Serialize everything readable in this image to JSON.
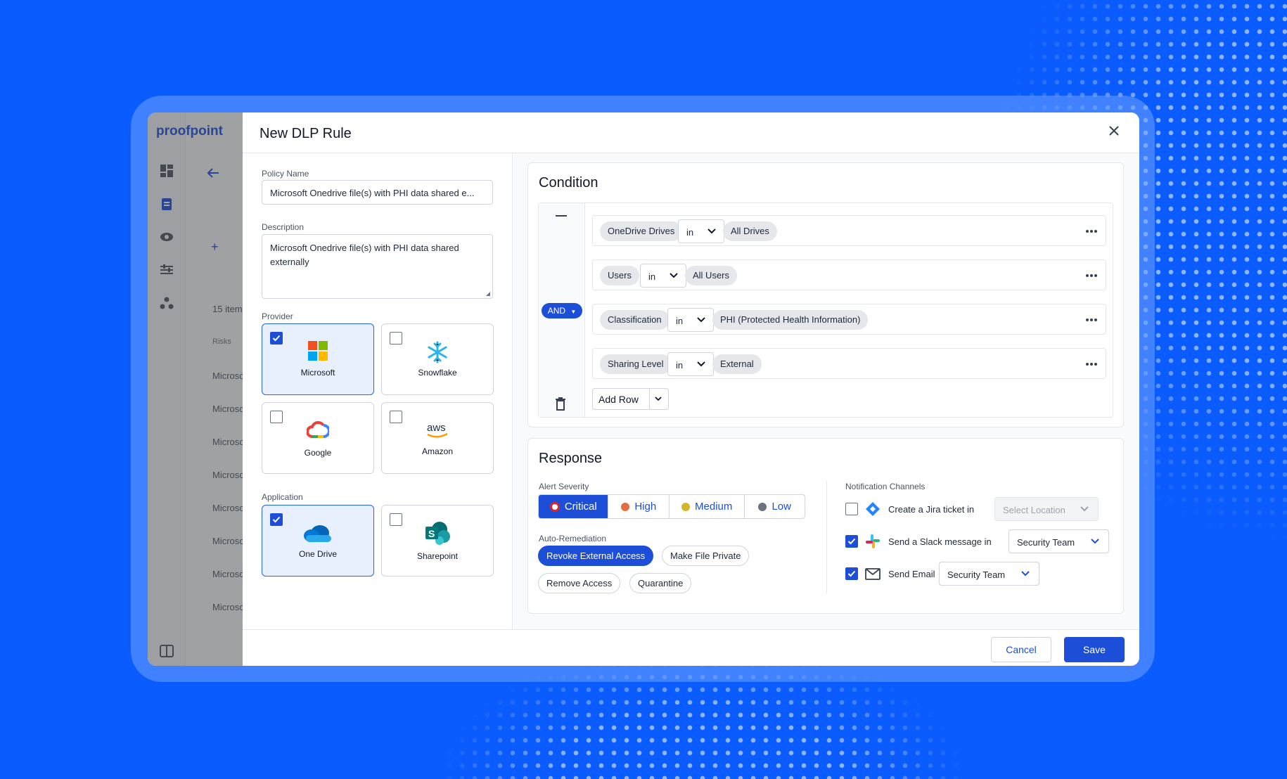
{
  "background_app": {
    "logo": "proofpoint",
    "items_count": "15 item",
    "table_header": "Risks",
    "rows": [
      "Microsc",
      "Microsc",
      "Microsc",
      "Microsc",
      "Microsc",
      "Microsc",
      "Microsc",
      "Microsc"
    ]
  },
  "modal": {
    "title": "New DLP Rule",
    "policy_name_label": "Policy Name",
    "policy_name_value": "Microsoft Onedrive file(s) with PHI data shared e...",
    "description_label": "Description",
    "description_value": "Microsoft Onedrive file(s) with PHI data shared externally",
    "provider_label": "Provider",
    "providers": [
      {
        "label": "Microsoft",
        "selected": true
      },
      {
        "label": "Snowflake",
        "selected": false
      },
      {
        "label": "Google",
        "selected": false
      },
      {
        "label": "Amazon",
        "selected": false
      }
    ],
    "application_label": "Application",
    "applications": [
      {
        "label": "One Drive",
        "selected": true
      },
      {
        "label": "Sharepoint",
        "selected": false
      }
    ]
  },
  "condition": {
    "title": "Condition",
    "operator": "AND",
    "rows": [
      {
        "field": "OneDrive Drives",
        "op": "in",
        "value": "All Drives"
      },
      {
        "field": "Users",
        "op": "in",
        "value": "All Users"
      },
      {
        "field": "Classification",
        "op": "in",
        "value": "PHI (Protected Health Information)"
      },
      {
        "field": "Sharing Level",
        "op": "in",
        "value": "External"
      }
    ],
    "add_row_label": "Add Row"
  },
  "response": {
    "title": "Response",
    "severity_label": "Alert Severity",
    "severities": [
      {
        "label": "Critical",
        "color": "#dc2626",
        "active": true
      },
      {
        "label": "High",
        "color": "#e07040"
      },
      {
        "label": "Medium",
        "color": "#d4b62b"
      },
      {
        "label": "Low",
        "color": "#6b7280"
      }
    ],
    "remediation_label": "Auto-Remediation",
    "remediations": [
      "Revoke External Access",
      "Make File Private",
      "Remove Access",
      "Quarantine"
    ],
    "notification_label": "Notification Channels",
    "notifications": [
      {
        "text": "Create a Jira ticket in",
        "checked": false,
        "dropdown": "Select Location",
        "icon": "jira-icon"
      },
      {
        "text": "Send a Slack message in",
        "checked": true,
        "dropdown": "Security Team",
        "icon": "slack-icon"
      },
      {
        "text": "Send Email",
        "checked": true,
        "dropdown": "Security Team",
        "icon": "mail-icon"
      }
    ]
  },
  "footer": {
    "cancel_label": "Cancel",
    "save_label": "Save"
  },
  "colors": {
    "primary": "#1d4ed8",
    "background": "#0a5cff"
  }
}
